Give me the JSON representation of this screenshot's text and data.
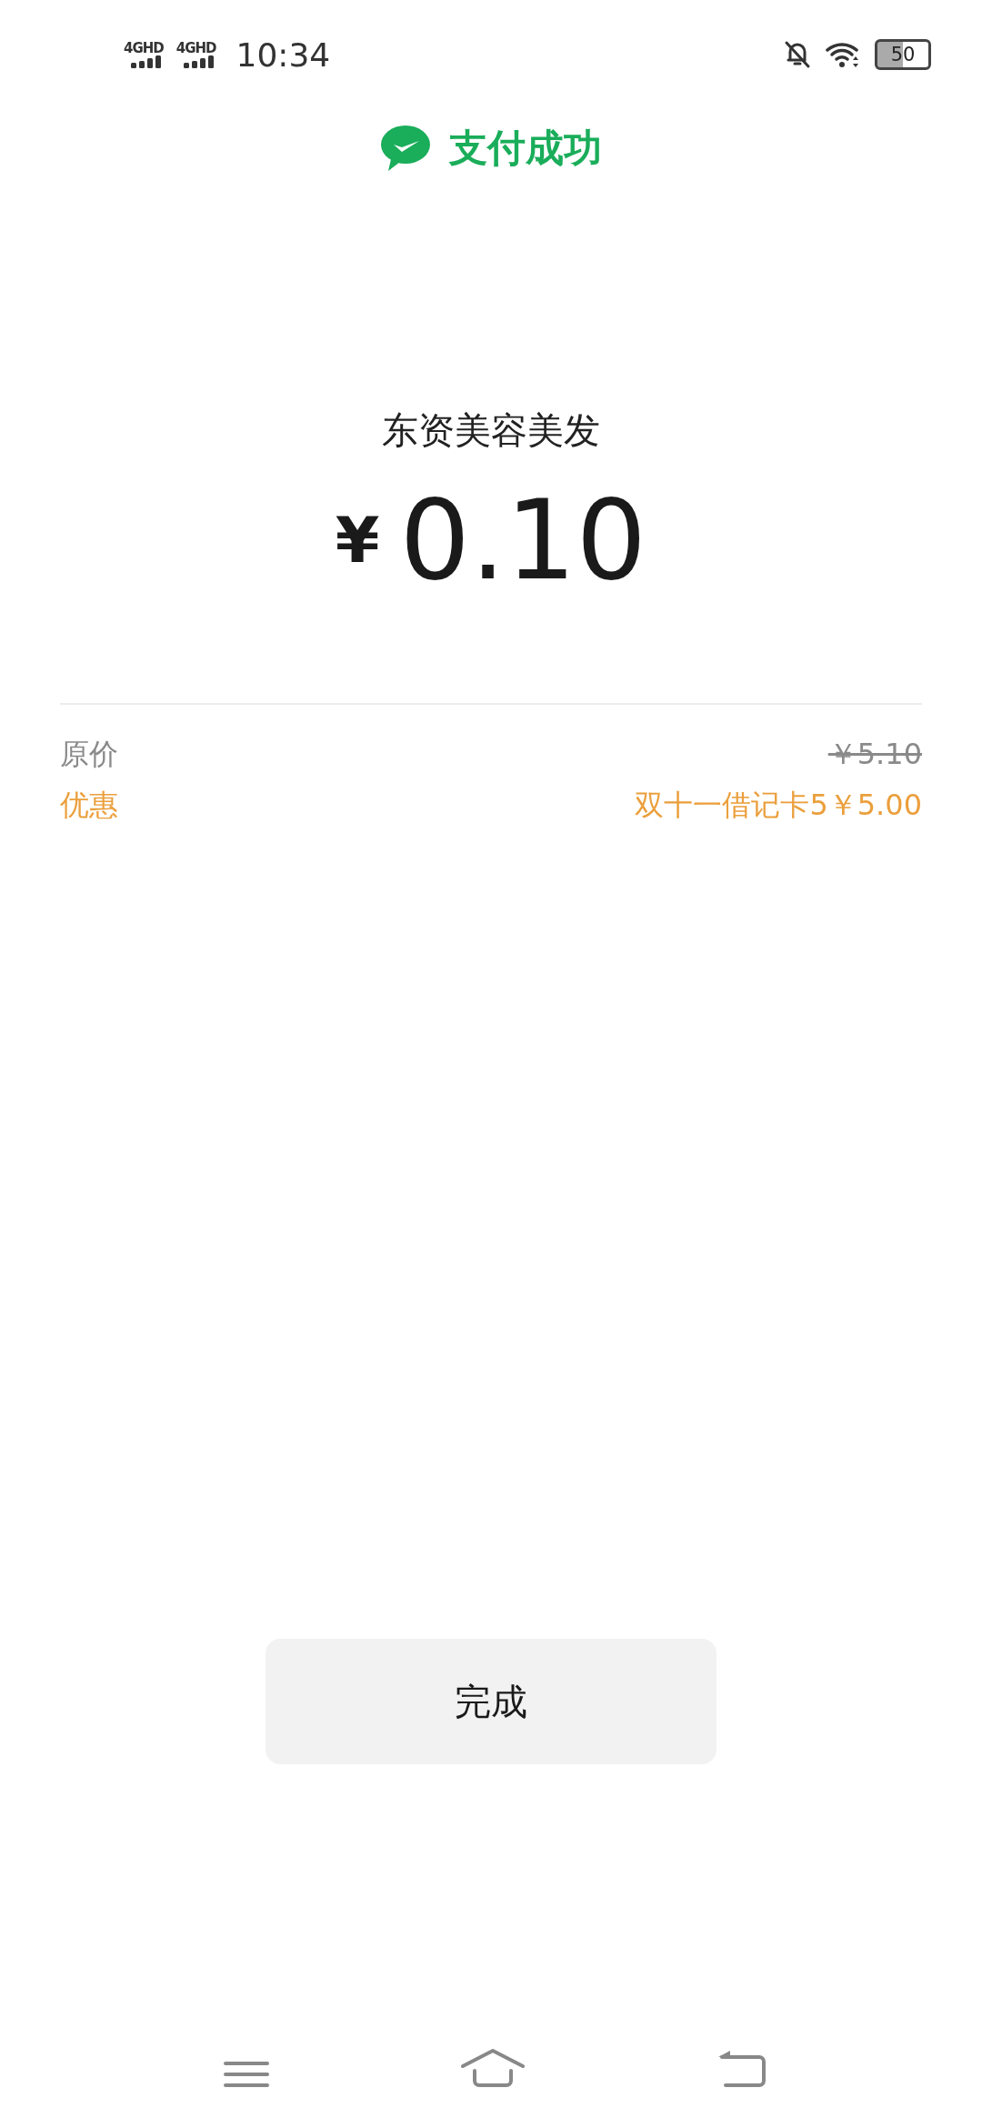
{
  "status_bar": {
    "signals": [
      "4GHD",
      "4GHD"
    ],
    "time": "10:34",
    "battery": "50"
  },
  "header": {
    "title": "支付成功"
  },
  "payment": {
    "merchant": "东资美容美发",
    "currency": "¥",
    "amount": "0.10"
  },
  "details": [
    {
      "kind": "original",
      "label": "原价",
      "value": "￥5.10"
    },
    {
      "kind": "discount",
      "label": "优惠",
      "value": "双十一借记卡5￥5.00"
    }
  ],
  "done_button": "完成"
}
